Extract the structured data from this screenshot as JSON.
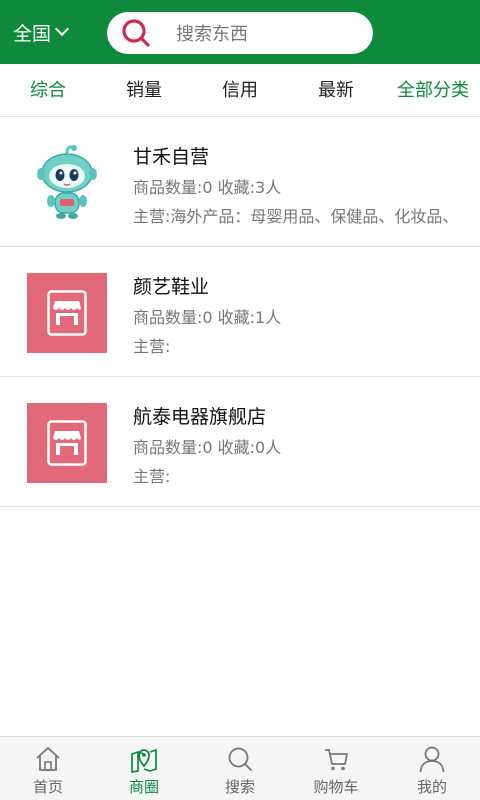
{
  "header": {
    "region_label": "全国",
    "search_placeholder": "搜索东西",
    "colors": {
      "brand": "#0f8a3c",
      "search_icon": "#d4264f"
    }
  },
  "filters": [
    {
      "label": "综合",
      "active": true
    },
    {
      "label": "销量",
      "active": false
    },
    {
      "label": "信用",
      "active": false
    },
    {
      "label": "最新",
      "active": false
    },
    {
      "label": "全部分类",
      "active": true
    }
  ],
  "shops": [
    {
      "name": "甘禾自营",
      "meta": "商品数量:0 收藏:3人",
      "main": "主营:海外产品：母婴用品、保健品、化妆品、",
      "thumb": "mascot-robot-logo"
    },
    {
      "name": "颜艺鞋业",
      "meta": "商品数量:0 收藏:1人",
      "main": "主营:",
      "thumb": "store-icon"
    },
    {
      "name": "航泰电器旗舰店",
      "meta": "商品数量:0 收藏:0人",
      "main": "主营:",
      "thumb": "store-icon"
    }
  ],
  "nav": [
    {
      "label": "首页",
      "icon": "home-icon",
      "active": false
    },
    {
      "label": "商圈",
      "icon": "map-pin-icon",
      "active": true
    },
    {
      "label": "搜索",
      "icon": "search-icon",
      "active": false
    },
    {
      "label": "购物车",
      "icon": "cart-icon",
      "active": false
    },
    {
      "label": "我的",
      "icon": "user-icon",
      "active": false
    }
  ]
}
